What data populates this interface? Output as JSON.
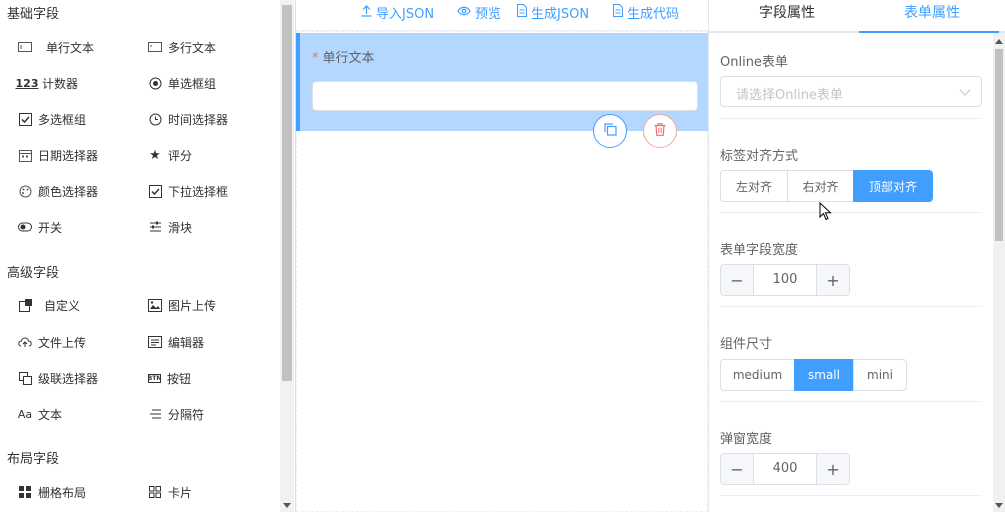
{
  "left_panel": {
    "groups": [
      {
        "title": "基础字段",
        "items": [
          {
            "label": "单行文本",
            "icon": "input-icon"
          },
          {
            "label": "多行文本",
            "icon": "textarea-icon"
          },
          {
            "label": "计数器",
            "icon": "number-icon",
            "icon_text": "123"
          },
          {
            "label": "单选框组",
            "icon": "radio-icon"
          },
          {
            "label": "多选框组",
            "icon": "checkbox-icon"
          },
          {
            "label": "时间选择器",
            "icon": "clock-icon"
          },
          {
            "label": "日期选择器",
            "icon": "calendar-icon"
          },
          {
            "label": "评分",
            "icon": "star-icon"
          },
          {
            "label": "颜色选择器",
            "icon": "palette-icon"
          },
          {
            "label": "下拉选择框",
            "icon": "select-icon"
          },
          {
            "label": "开关",
            "icon": "switch-icon"
          },
          {
            "label": "滑块",
            "icon": "slider-icon"
          }
        ]
      },
      {
        "title": "高级字段",
        "items": [
          {
            "label": "自定义",
            "icon": "custom-icon"
          },
          {
            "label": "图片上传",
            "icon": "image-icon"
          },
          {
            "label": "文件上传",
            "icon": "cloud-upload-icon"
          },
          {
            "label": "编辑器",
            "icon": "editor-icon"
          },
          {
            "label": "级联选择器",
            "icon": "cascader-icon"
          },
          {
            "label": "按钮",
            "icon": "button-icon",
            "icon_text": "BTN"
          },
          {
            "label": "文本",
            "icon": "text-icon",
            "icon_text": "Aa"
          },
          {
            "label": "分隔符",
            "icon": "divider-icon"
          }
        ]
      },
      {
        "title": "布局字段",
        "items": [
          {
            "label": "栅格布局",
            "icon": "grid-icon"
          },
          {
            "label": "卡片",
            "icon": "card-icon"
          }
        ]
      }
    ]
  },
  "toolbar": {
    "import_json": "导入JSON",
    "preview": "预览",
    "generate_json": "生成JSON",
    "generate_code": "生成代码"
  },
  "canvas": {
    "field_label": "单行文本",
    "required_mark": "*"
  },
  "right_panel": {
    "tabs": [
      "字段属性",
      "表单属性"
    ],
    "active_tab": 1,
    "online_form": {
      "label": "Online表单",
      "placeholder": "请选择Online表单"
    },
    "label_align": {
      "label": "标签对齐方式",
      "options": [
        "左对齐",
        "右对齐",
        "顶部对齐"
      ],
      "selected": 2
    },
    "field_width": {
      "label": "表单字段宽度",
      "value": "100",
      "minus": "−",
      "plus": "+"
    },
    "size": {
      "label": "组件尺寸",
      "options": [
        "medium",
        "small",
        "mini"
      ],
      "selected": 1
    },
    "dialog_width": {
      "label": "弹窗宽度",
      "value": "400",
      "minus": "−",
      "plus": "+"
    }
  },
  "colors": {
    "primary": "#409eff",
    "danger": "#f56c6c",
    "selected_bg": "#b3d7ff"
  }
}
